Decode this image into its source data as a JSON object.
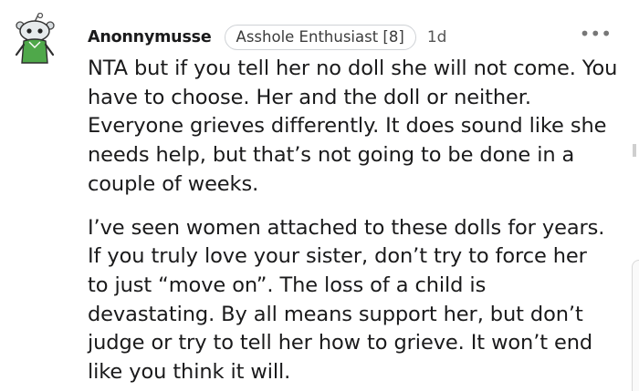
{
  "comment": {
    "author": "Anonnymusse",
    "flair": "Asshole Enthusiast [8]",
    "age": "1d",
    "more_icon": "more-horizontal-icon",
    "avatar_icon": "snoo-avatar-icon",
    "paragraphs": [
      "NTA but if you tell her no doll she will not come. You have to choose. Her and the doll or neither. Everyone grieves differently. It does sound like she needs help, but that’s not going to be done in a couple of weeks.",
      "I’ve seen women attached to these dolls for years. If you truly love your sister, don’t try to force her to just “move on”. The loss of a child is devastating. By all means support her, but don’t judge or try to tell her how to grieve. It won’t end like you think it will."
    ]
  },
  "colors": {
    "text": "#1a1a1b",
    "meta": "#555555",
    "flair_border": "#cfd2d6",
    "avatar_green": "#4fa84a"
  }
}
